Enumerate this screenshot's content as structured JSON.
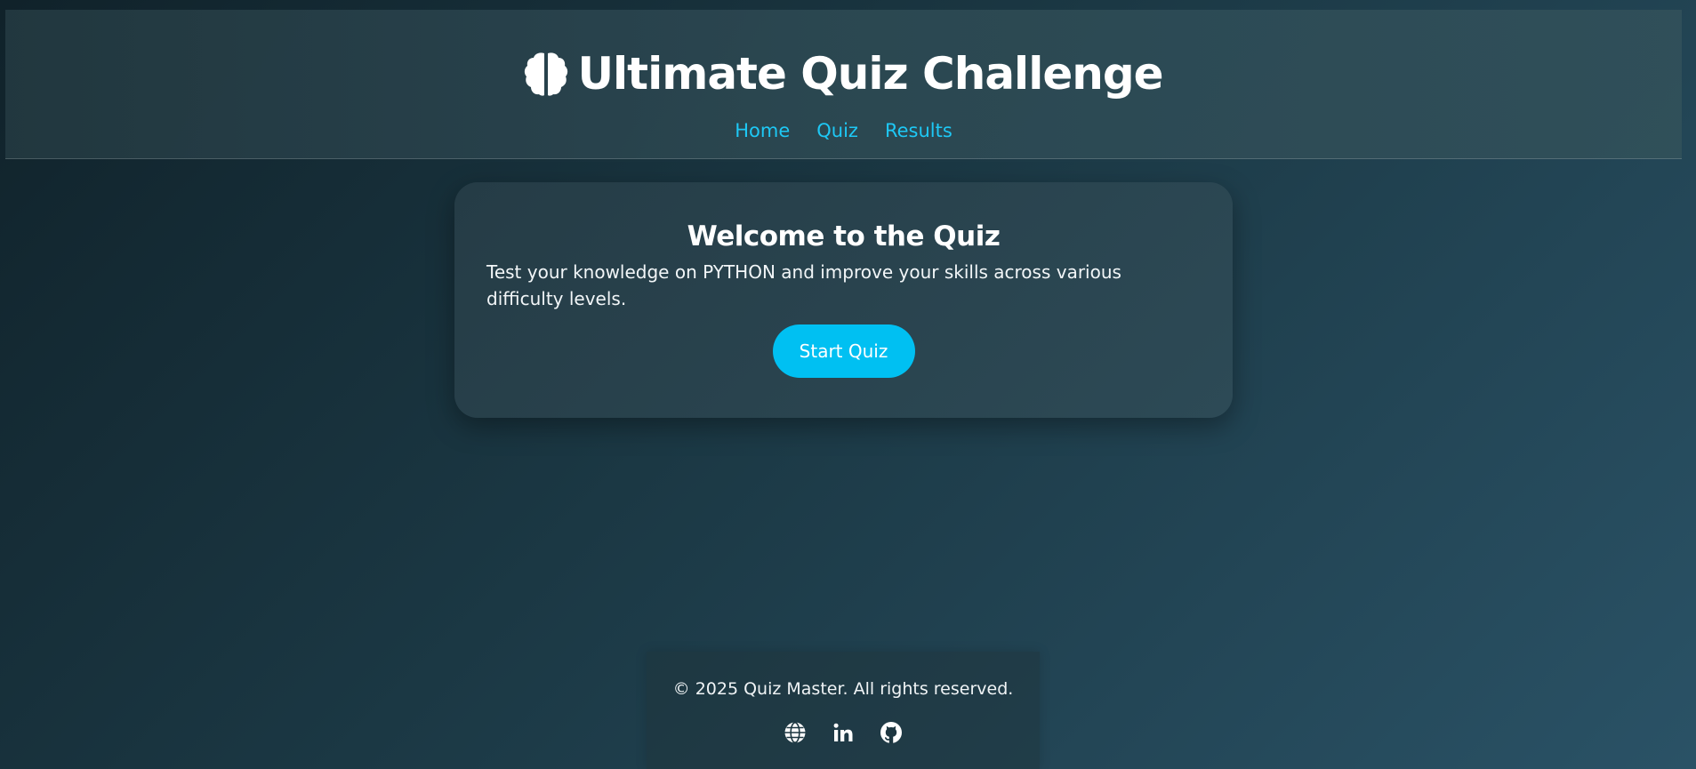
{
  "header": {
    "title": "Ultimate Quiz Challenge",
    "logo_icon": "brain-icon",
    "nav": [
      {
        "label": "Home"
      },
      {
        "label": "Quiz"
      },
      {
        "label": "Results"
      }
    ]
  },
  "welcome": {
    "title": "Welcome to the Quiz",
    "text": "Test your knowledge on PYTHON and improve your skills across various difficulty levels.",
    "button_label": "Start Quiz"
  },
  "footer": {
    "copyright": "© 2025 Quiz Master. All rights reserved.",
    "socials": [
      {
        "icon": "globe-icon"
      },
      {
        "icon": "linkedin-icon",
        "text": "in"
      },
      {
        "icon": "github-icon"
      }
    ]
  },
  "colors": {
    "accent": "#00c0f2",
    "nav_link": "#1ec8f5",
    "background_dark": "#10222a",
    "background_light": "#2a5266"
  }
}
